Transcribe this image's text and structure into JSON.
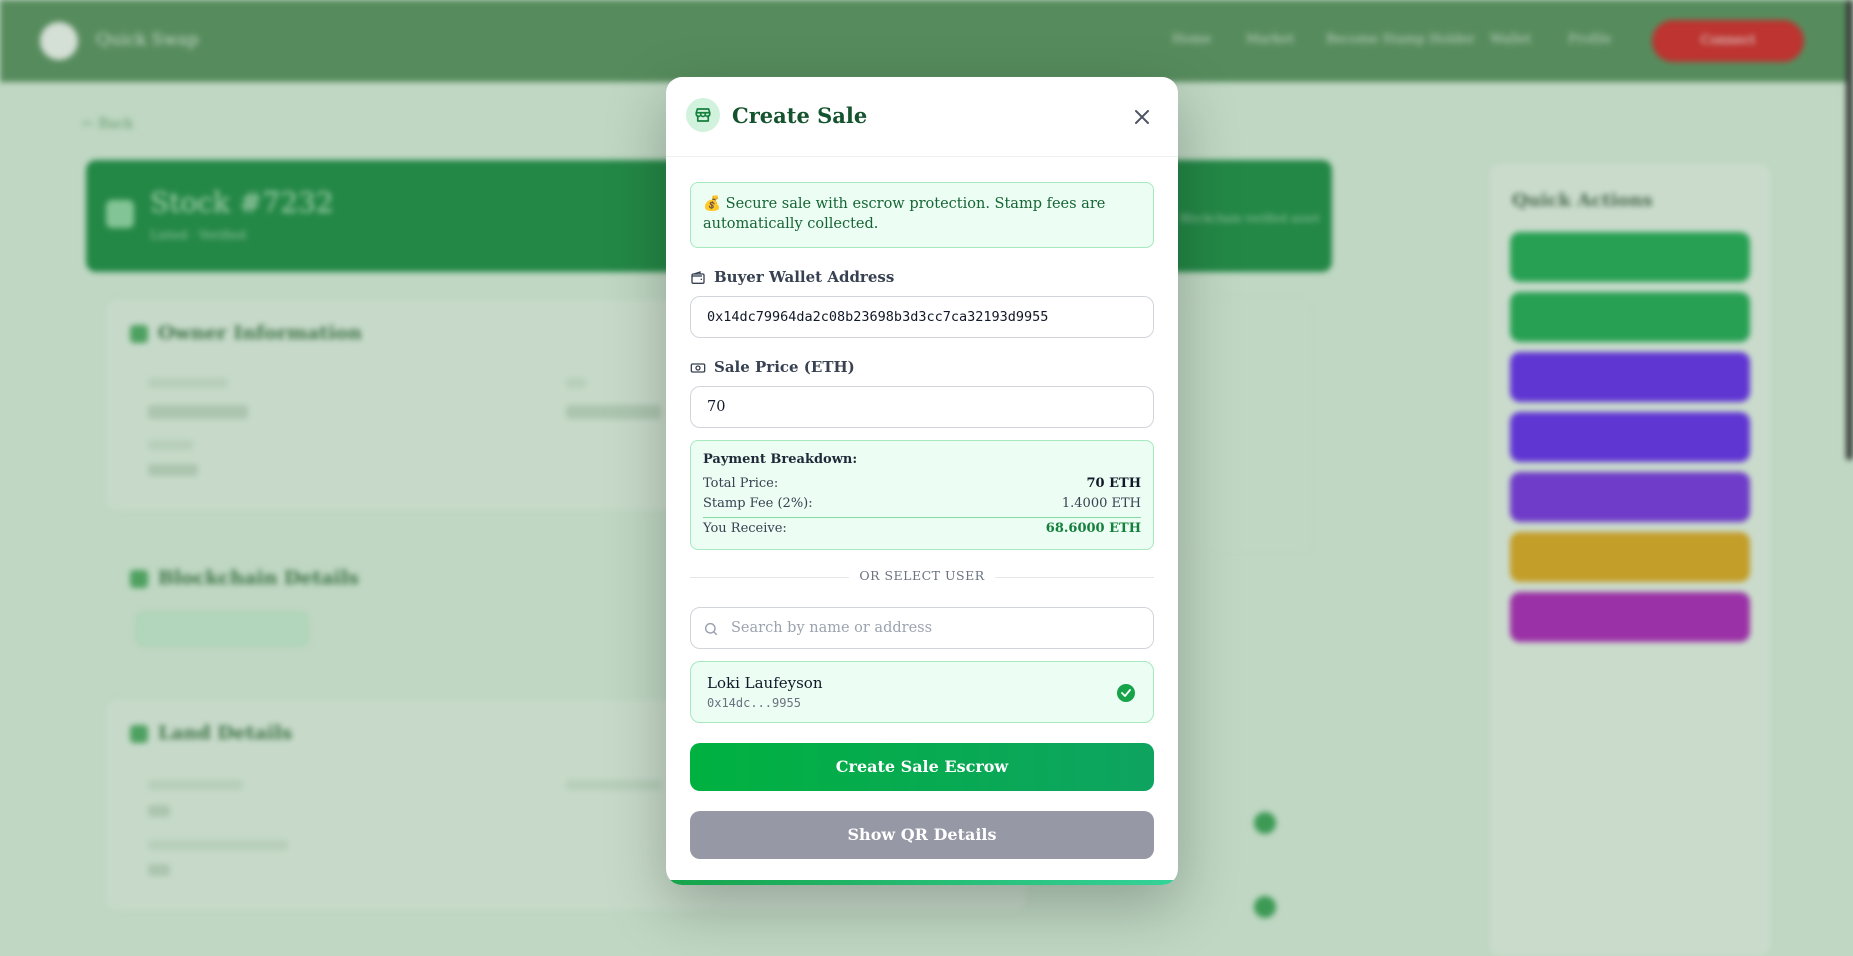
{
  "background": {
    "brand": "Quick Swap",
    "nav": [
      "Home",
      "Market",
      "Become Stamp Holder",
      "Wallet",
      "Profile"
    ],
    "nav_cta": "Connect",
    "breadcrumb": "← Back",
    "hero": {
      "title": "Stock #7232",
      "subtitle": "Listed · Verified",
      "right_text": "Blockchain verified asset"
    },
    "sections": [
      "Owner Information",
      "Blockchain Details",
      "Land Details"
    ],
    "side_title": "Quick Actions"
  },
  "modal": {
    "title": "Create Sale",
    "close_icon": "close-icon",
    "info_text": "💰 Secure sale with escrow protection. Stamp fees are automatically collected.",
    "buyer": {
      "label": "Buyer Wallet Address",
      "value": "0x14dc79964da2c08b23698b3d3cc7ca32193d9955"
    },
    "price": {
      "label": "Sale Price (ETH)",
      "value": "70"
    },
    "breakdown": {
      "title": "Payment Breakdown:",
      "total_label": "Total Price:",
      "total_value": "70 ETH",
      "fee_label": "Stamp Fee (2%):",
      "fee_value": "1.4000 ETH",
      "receive_label": "You Receive:",
      "receive_value": "68.6000 ETH"
    },
    "divider": "OR SELECT USER",
    "search": {
      "placeholder": "Search by name or address",
      "value": ""
    },
    "selected_user": {
      "name": "Loki Laufeyson",
      "address": "0x14dc...9955"
    },
    "primary_button": "Create Sale Escrow",
    "secondary_button": "Show QR Details"
  },
  "colors": {
    "brand_green": "#16a34a",
    "accent_light": "#ecfdf3",
    "secondary_button": "#9698a6"
  }
}
